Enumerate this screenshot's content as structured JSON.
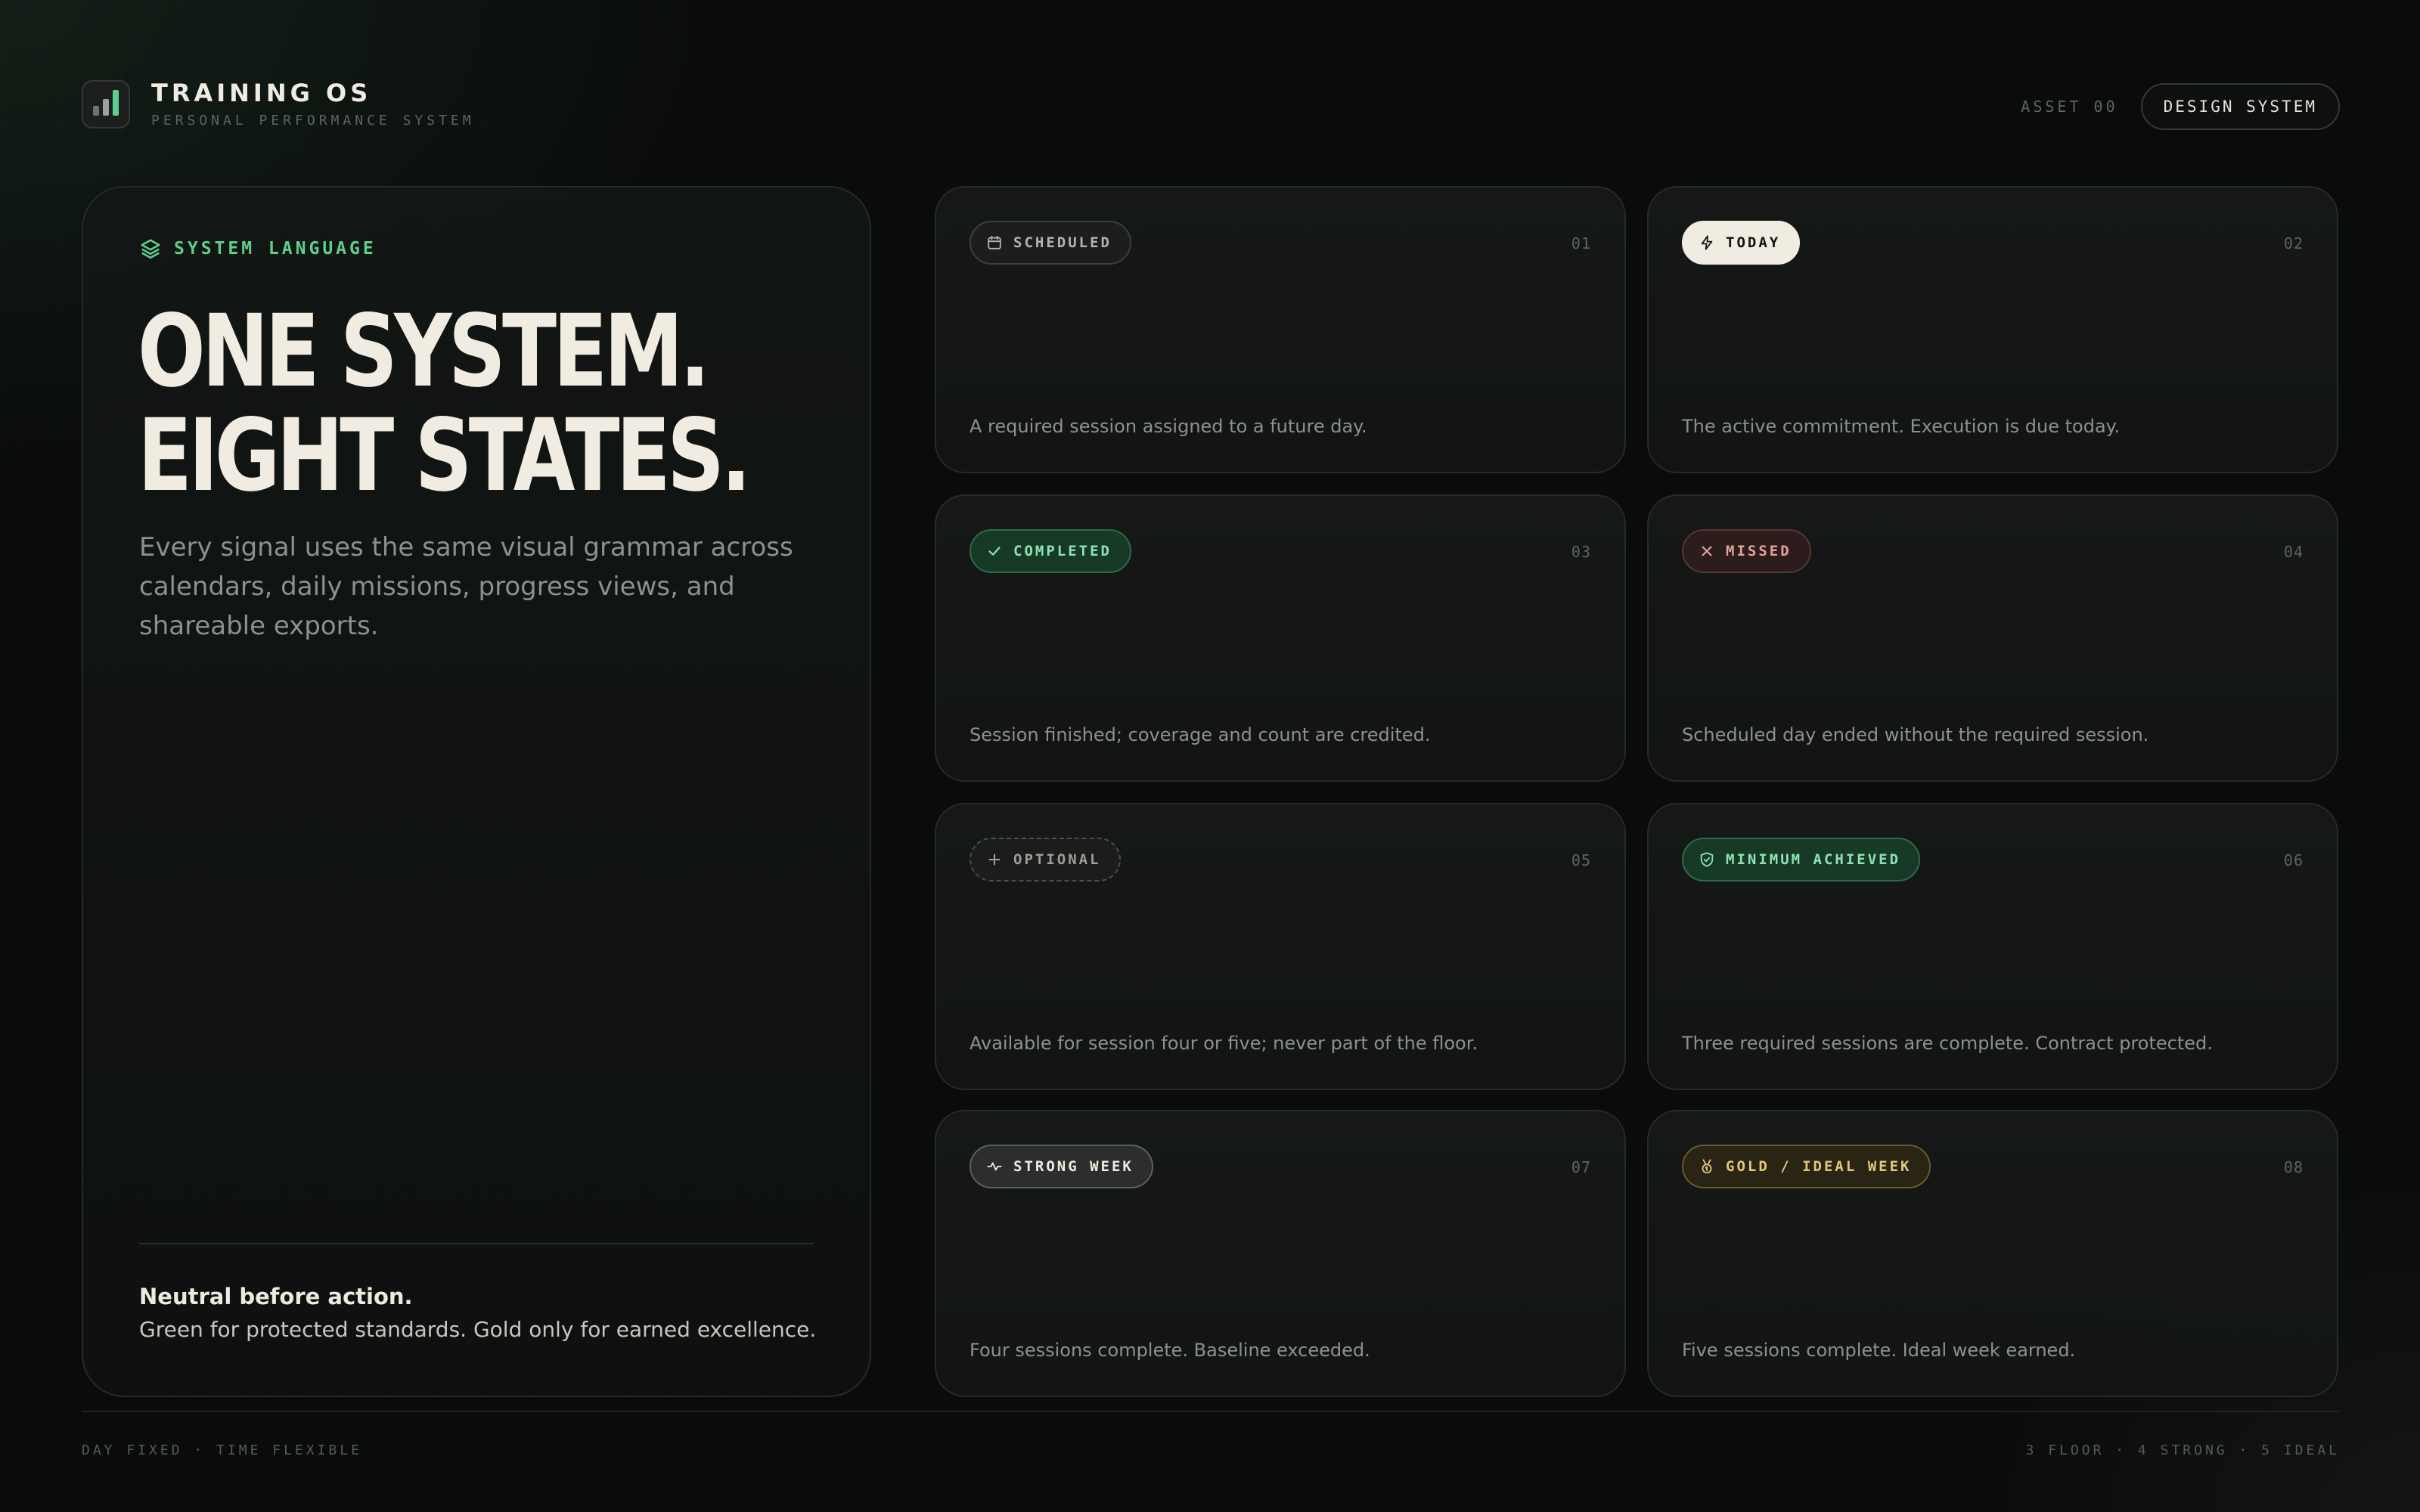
{
  "brand": {
    "title": "TRAINING OS",
    "subtitle": "PERSONAL PERFORMANCE SYSTEM",
    "icon": "bar-chart-icon"
  },
  "header": {
    "asset_label": "ASSET 00",
    "badge_label": "DESIGN SYSTEM"
  },
  "hero": {
    "kicker": "SYSTEM LANGUAGE",
    "kicker_icon": "layers-icon",
    "title_line1": "ONE SYSTEM.",
    "title_line2": "EIGHT STATES.",
    "description": "Every signal uses the same visual grammar across calendars, daily missions, progress views, and shareable exports.",
    "note_title": "Neutral before action.",
    "note_body": "Green for protected standards. Gold only for earned excellence."
  },
  "states": [
    {
      "label": "SCHEDULED",
      "number": "01",
      "description": "A required session assigned to a future day.",
      "icon": "calendar-icon"
    },
    {
      "label": "TODAY",
      "number": "02",
      "description": "The active commitment. Execution is due today.",
      "icon": "bolt-icon"
    },
    {
      "label": "COMPLETED",
      "number": "03",
      "description": "Session finished; coverage and count are credited.",
      "icon": "check-icon"
    },
    {
      "label": "MISSED",
      "number": "04",
      "description": "Scheduled day ended without the required session.",
      "icon": "x-icon"
    },
    {
      "label": "OPTIONAL",
      "number": "05",
      "description": "Available for session four or five; never part of the floor.",
      "icon": "plus-icon"
    },
    {
      "label": "MINIMUM ACHIEVED",
      "number": "06",
      "description": "Three required sessions are complete. Contract protected.",
      "icon": "shield-check-icon"
    },
    {
      "label": "STRONG WEEK",
      "number": "07",
      "description": "Four sessions complete. Baseline exceeded.",
      "icon": "activity-icon"
    },
    {
      "label": "GOLD / IDEAL WEEK",
      "number": "08",
      "description": "Five sessions complete. Ideal week earned.",
      "icon": "medal-icon"
    }
  ],
  "colors": {
    "accent_green": "#5fcf8e",
    "gold": "#e3c77d",
    "missed_red": "#e0a39b",
    "ink": "#f1ece2"
  },
  "footer": {
    "left": "DAY FIXED · TIME FLEXIBLE",
    "right": "3 FLOOR · 4 STRONG · 5 IDEAL"
  }
}
